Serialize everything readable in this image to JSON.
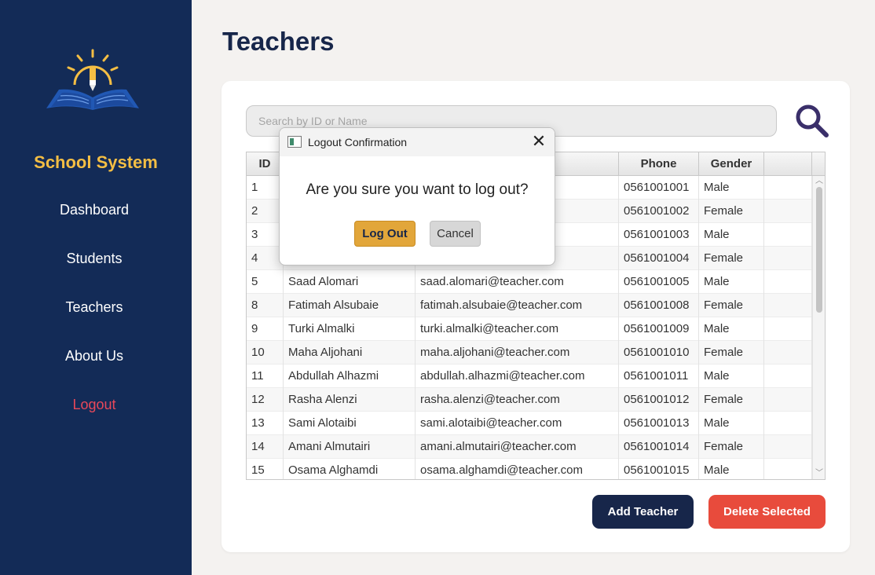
{
  "sidebar": {
    "brand": "School System",
    "nav": [
      "Dashboard",
      "Students",
      "Teachers",
      "About Us",
      "Logout"
    ]
  },
  "page": {
    "title": "Teachers"
  },
  "search": {
    "placeholder": "Search by ID or Name"
  },
  "table": {
    "columns": [
      "ID",
      "",
      "",
      "Phone",
      "Gender"
    ],
    "rows": [
      {
        "id": "1",
        "name": "",
        "email": "m",
        "phone": "0561001001",
        "gender": "Male"
      },
      {
        "id": "2",
        "name": "",
        "email": "m",
        "phone": "0561001002",
        "gender": "Female"
      },
      {
        "id": "3",
        "name": "",
        "email": "acher.com",
        "phone": "0561001003",
        "gender": "Male"
      },
      {
        "id": "4",
        "name": "",
        "email": "com",
        "phone": "0561001004",
        "gender": "Female"
      },
      {
        "id": "5",
        "name": "Saad Alomari",
        "email": "saad.alomari@teacher.com",
        "phone": "0561001005",
        "gender": "Male"
      },
      {
        "id": "8",
        "name": "Fatimah Alsubaie",
        "email": "fatimah.alsubaie@teacher.com",
        "phone": "0561001008",
        "gender": "Female"
      },
      {
        "id": "9",
        "name": "Turki Almalki",
        "email": "turki.almalki@teacher.com",
        "phone": "0561001009",
        "gender": "Male"
      },
      {
        "id": "10",
        "name": "Maha Aljohani",
        "email": "maha.aljohani@teacher.com",
        "phone": "0561001010",
        "gender": "Female"
      },
      {
        "id": "11",
        "name": "Abdullah Alhazmi",
        "email": "abdullah.alhazmi@teacher.com",
        "phone": "0561001011",
        "gender": "Male"
      },
      {
        "id": "12",
        "name": "Rasha Alenzi",
        "email": "rasha.alenzi@teacher.com",
        "phone": "0561001012",
        "gender": "Female"
      },
      {
        "id": "13",
        "name": "Sami Alotaibi",
        "email": "sami.alotaibi@teacher.com",
        "phone": "0561001013",
        "gender": "Male"
      },
      {
        "id": "14",
        "name": "Amani Almutairi",
        "email": "amani.almutairi@teacher.com",
        "phone": "0561001014",
        "gender": "Female"
      },
      {
        "id": "15",
        "name": "Osama Alghamdi",
        "email": "osama.alghamdi@teacher.com",
        "phone": "0561001015",
        "gender": "Male"
      }
    ]
  },
  "actions": {
    "add": "Add Teacher",
    "delete": "Delete Selected"
  },
  "dialog": {
    "title": "Logout Confirmation",
    "message": "Are you sure you want to log out?",
    "confirm": "Log Out",
    "cancel": "Cancel"
  },
  "colors": {
    "sidebar": "#132b57",
    "brand": "#f4be44",
    "logout": "#e8485a",
    "primary": "#17264a",
    "danger": "#e84b3c",
    "confirm": "#e2a63a"
  }
}
